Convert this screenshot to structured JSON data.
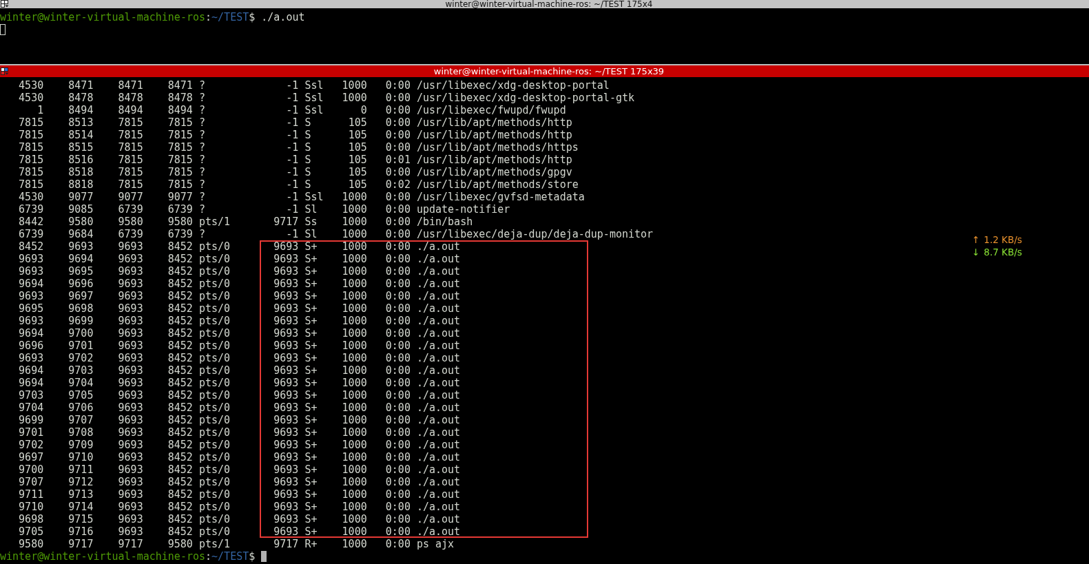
{
  "top_terminal": {
    "title": "winter@winter-virtual-machine-ros: ~/TEST 175x4",
    "active": false,
    "prompt": {
      "user_host": "winter@winter-virtual-machine-ros",
      "separator": ":",
      "path": "~/TEST",
      "symbol": "$",
      "command": "./a.out"
    },
    "cursor_focused": false
  },
  "bottom_terminal": {
    "title": "winter@winter-virtual-machine-ros: ~/TEST 175x39",
    "active": true,
    "row_groups": [
      {
        "highlighted": false,
        "rows": [
          {
            "cells": [
              "4530",
              "8471",
              "8471",
              "8471",
              "?",
              "-1",
              "Ssl",
              "1000",
              "0:00",
              "/usr/libexec/xdg-desktop-portal"
            ]
          },
          {
            "cells": [
              "4530",
              "8478",
              "8478",
              "8478",
              "?",
              "-1",
              "Ssl",
              "1000",
              "0:00",
              "/usr/libexec/xdg-desktop-portal-gtk"
            ]
          },
          {
            "cells": [
              "1",
              "8494",
              "8494",
              "8494",
              "?",
              "-1",
              "Ssl",
              "0",
              "0:00",
              "/usr/libexec/fwupd/fwupd"
            ]
          },
          {
            "cells": [
              "7815",
              "8513",
              "7815",
              "7815",
              "?",
              "-1",
              "S",
              "105",
              "0:00",
              "/usr/lib/apt/methods/http"
            ]
          },
          {
            "cells": [
              "7815",
              "8514",
              "7815",
              "7815",
              "?",
              "-1",
              "S",
              "105",
              "0:00",
              "/usr/lib/apt/methods/http"
            ]
          },
          {
            "cells": [
              "7815",
              "8515",
              "7815",
              "7815",
              "?",
              "-1",
              "S",
              "105",
              "0:00",
              "/usr/lib/apt/methods/https"
            ]
          },
          {
            "cells": [
              "7815",
              "8516",
              "7815",
              "7815",
              "?",
              "-1",
              "S",
              "105",
              "0:01",
              "/usr/lib/apt/methods/http"
            ]
          },
          {
            "cells": [
              "7815",
              "8518",
              "7815",
              "7815",
              "?",
              "-1",
              "S",
              "105",
              "0:00",
              "/usr/lib/apt/methods/gpgv"
            ]
          },
          {
            "cells": [
              "7815",
              "8818",
              "7815",
              "7815",
              "?",
              "-1",
              "S",
              "105",
              "0:02",
              "/usr/lib/apt/methods/store"
            ]
          },
          {
            "cells": [
              "4530",
              "9077",
              "9077",
              "9077",
              "?",
              "-1",
              "Ssl",
              "1000",
              "0:00",
              "/usr/libexec/gvfsd-metadata"
            ]
          },
          {
            "cells": [
              "6739",
              "9085",
              "6739",
              "6739",
              "?",
              "-1",
              "Sl",
              "1000",
              "0:00",
              "update-notifier"
            ]
          },
          {
            "cells": [
              "8442",
              "9580",
              "9580",
              "9580",
              "pts/1",
              "9717",
              "Ss",
              "1000",
              "0:00",
              "/bin/bash"
            ]
          },
          {
            "cells": [
              "6739",
              "9684",
              "6739",
              "6739",
              "?",
              "-1",
              "Sl",
              "1000",
              "0:00",
              "/usr/libexec/deja-dup/deja-dup-monitor"
            ]
          }
        ]
      },
      {
        "highlighted": true,
        "rows": [
          {
            "cells": [
              "8452",
              "9693",
              "9693",
              "8452",
              "pts/0",
              "9693",
              "S+",
              "1000",
              "0:00",
              "./a.out"
            ]
          },
          {
            "cells": [
              "9693",
              "9694",
              "9693",
              "8452",
              "pts/0",
              "9693",
              "S+",
              "1000",
              "0:00",
              "./a.out"
            ]
          },
          {
            "cells": [
              "9693",
              "9695",
              "9693",
              "8452",
              "pts/0",
              "9693",
              "S+",
              "1000",
              "0:00",
              "./a.out"
            ]
          },
          {
            "cells": [
              "9694",
              "9696",
              "9693",
              "8452",
              "pts/0",
              "9693",
              "S+",
              "1000",
              "0:00",
              "./a.out"
            ]
          },
          {
            "cells": [
              "9693",
              "9697",
              "9693",
              "8452",
              "pts/0",
              "9693",
              "S+",
              "1000",
              "0:00",
              "./a.out"
            ]
          },
          {
            "cells": [
              "9695",
              "9698",
              "9693",
              "8452",
              "pts/0",
              "9693",
              "S+",
              "1000",
              "0:00",
              "./a.out"
            ]
          },
          {
            "cells": [
              "9693",
              "9699",
              "9693",
              "8452",
              "pts/0",
              "9693",
              "S+",
              "1000",
              "0:00",
              "./a.out"
            ]
          },
          {
            "cells": [
              "9694",
              "9700",
              "9693",
              "8452",
              "pts/0",
              "9693",
              "S+",
              "1000",
              "0:00",
              "./a.out"
            ]
          },
          {
            "cells": [
              "9696",
              "9701",
              "9693",
              "8452",
              "pts/0",
              "9693",
              "S+",
              "1000",
              "0:00",
              "./a.out"
            ]
          },
          {
            "cells": [
              "9693",
              "9702",
              "9693",
              "8452",
              "pts/0",
              "9693",
              "S+",
              "1000",
              "0:00",
              "./a.out"
            ]
          },
          {
            "cells": [
              "9694",
              "9703",
              "9693",
              "8452",
              "pts/0",
              "9693",
              "S+",
              "1000",
              "0:00",
              "./a.out"
            ]
          },
          {
            "cells": [
              "9694",
              "9704",
              "9693",
              "8452",
              "pts/0",
              "9693",
              "S+",
              "1000",
              "0:00",
              "./a.out"
            ]
          },
          {
            "cells": [
              "9703",
              "9705",
              "9693",
              "8452",
              "pts/0",
              "9693",
              "S+",
              "1000",
              "0:00",
              "./a.out"
            ]
          },
          {
            "cells": [
              "9704",
              "9706",
              "9693",
              "8452",
              "pts/0",
              "9693",
              "S+",
              "1000",
              "0:00",
              "./a.out"
            ]
          },
          {
            "cells": [
              "9699",
              "9707",
              "9693",
              "8452",
              "pts/0",
              "9693",
              "S+",
              "1000",
              "0:00",
              "./a.out"
            ]
          },
          {
            "cells": [
              "9701",
              "9708",
              "9693",
              "8452",
              "pts/0",
              "9693",
              "S+",
              "1000",
              "0:00",
              "./a.out"
            ]
          },
          {
            "cells": [
              "9702",
              "9709",
              "9693",
              "8452",
              "pts/0",
              "9693",
              "S+",
              "1000",
              "0:00",
              "./a.out"
            ]
          },
          {
            "cells": [
              "9697",
              "9710",
              "9693",
              "8452",
              "pts/0",
              "9693",
              "S+",
              "1000",
              "0:00",
              "./a.out"
            ]
          },
          {
            "cells": [
              "9700",
              "9711",
              "9693",
              "8452",
              "pts/0",
              "9693",
              "S+",
              "1000",
              "0:00",
              "./a.out"
            ]
          },
          {
            "cells": [
              "9707",
              "9712",
              "9693",
              "8452",
              "pts/0",
              "9693",
              "S+",
              "1000",
              "0:00",
              "./a.out"
            ]
          },
          {
            "cells": [
              "9711",
              "9713",
              "9693",
              "8452",
              "pts/0",
              "9693",
              "S+",
              "1000",
              "0:00",
              "./a.out"
            ]
          },
          {
            "cells": [
              "9710",
              "9714",
              "9693",
              "8452",
              "pts/0",
              "9693",
              "S+",
              "1000",
              "0:00",
              "./a.out"
            ]
          },
          {
            "cells": [
              "9698",
              "9715",
              "9693",
              "8452",
              "pts/0",
              "9693",
              "S+",
              "1000",
              "0:00",
              "./a.out"
            ]
          },
          {
            "cells": [
              "9705",
              "9716",
              "9693",
              "8452",
              "pts/0",
              "9693",
              "S+",
              "1000",
              "0:00",
              "./a.out"
            ]
          }
        ]
      },
      {
        "highlighted": false,
        "rows": [
          {
            "cells": [
              "9580",
              "9717",
              "9717",
              "9580",
              "pts/1",
              "9717",
              "R+",
              "1000",
              "0:00",
              "ps ajx"
            ]
          }
        ]
      }
    ],
    "prompt": {
      "user_host": "winter@winter-virtual-machine-ros",
      "separator": ":",
      "path": "~/TEST",
      "symbol": "$"
    },
    "cursor_focused": true
  },
  "network_monitor": {
    "upload_arrow": "↑",
    "upload": "1.2 KB/s",
    "download_arrow": "↓",
    "download": "8.7 KB/s"
  }
}
